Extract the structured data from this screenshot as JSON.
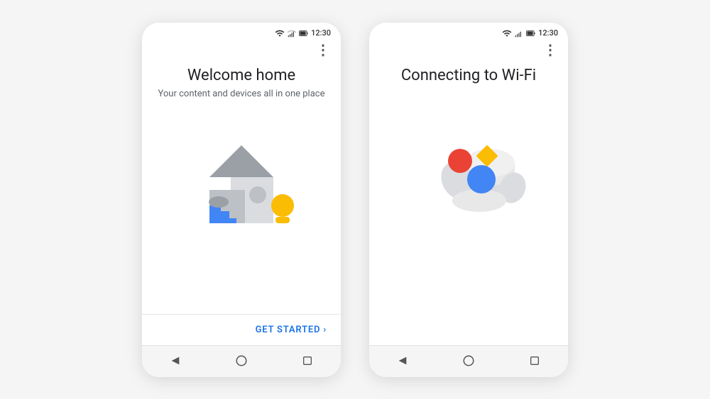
{
  "phone1": {
    "status": {
      "time": "12:30"
    },
    "menu": "⋮",
    "title": "Welcome home",
    "subtitle": "Your content and devices all in one place",
    "cta": "GET STARTED",
    "cta_arrow": "›"
  },
  "phone2": {
    "status": {
      "time": "12:30"
    },
    "menu": "⋮",
    "title": "Connecting to Wi-Fi"
  },
  "colors": {
    "blue": "#4285f4",
    "yellow": "#fbbc04",
    "red": "#ea4335",
    "gray_dark": "#9aa0a6",
    "gray_mid": "#bdc1c6",
    "gray_light": "#dadce0",
    "house_roof": "#9aa0a6",
    "house_body": "#dadce0",
    "house_square": "#bdc1c6",
    "accent_blue": "#1a73e8"
  }
}
